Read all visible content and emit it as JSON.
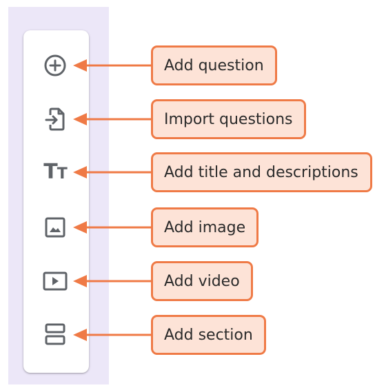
{
  "colors": {
    "panel_background": "#ece7f8",
    "toolbar_background": "#ffffff",
    "icon_color": "#5f6368",
    "callout_fill": "#fde3d7",
    "callout_border": "#ef7a46",
    "arrow_color": "#ef7a46"
  },
  "toolbar": {
    "items": [
      {
        "icon": "add-circle-icon",
        "callout": "Add question"
      },
      {
        "icon": "import-file-icon",
        "callout": "Import questions"
      },
      {
        "icon": "title-text-icon",
        "glyph_big": "T",
        "glyph_small": "T",
        "callout": "Add title and descriptions"
      },
      {
        "icon": "image-icon",
        "callout": "Add image"
      },
      {
        "icon": "video-play-icon",
        "callout": "Add video"
      },
      {
        "icon": "section-icon",
        "callout": "Add section"
      }
    ]
  }
}
